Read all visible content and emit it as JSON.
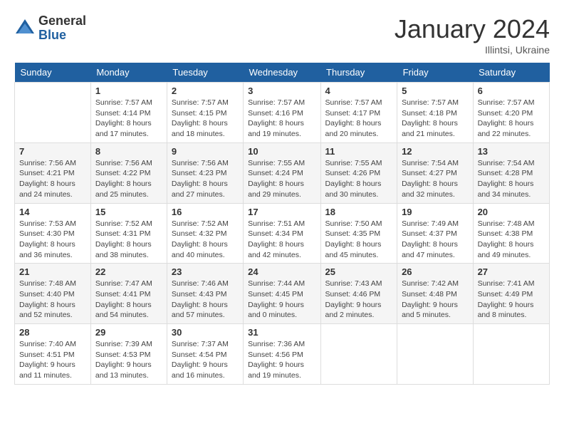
{
  "header": {
    "logo_general": "General",
    "logo_blue": "Blue",
    "month_title": "January 2024",
    "location": "Illintsi, Ukraine"
  },
  "days_of_week": [
    "Sunday",
    "Monday",
    "Tuesday",
    "Wednesday",
    "Thursday",
    "Friday",
    "Saturday"
  ],
  "weeks": [
    [
      {
        "num": "",
        "sunrise": "",
        "sunset": "",
        "daylight": ""
      },
      {
        "num": "1",
        "sunrise": "Sunrise: 7:57 AM",
        "sunset": "Sunset: 4:14 PM",
        "daylight": "Daylight: 8 hours and 17 minutes."
      },
      {
        "num": "2",
        "sunrise": "Sunrise: 7:57 AM",
        "sunset": "Sunset: 4:15 PM",
        "daylight": "Daylight: 8 hours and 18 minutes."
      },
      {
        "num": "3",
        "sunrise": "Sunrise: 7:57 AM",
        "sunset": "Sunset: 4:16 PM",
        "daylight": "Daylight: 8 hours and 19 minutes."
      },
      {
        "num": "4",
        "sunrise": "Sunrise: 7:57 AM",
        "sunset": "Sunset: 4:17 PM",
        "daylight": "Daylight: 8 hours and 20 minutes."
      },
      {
        "num": "5",
        "sunrise": "Sunrise: 7:57 AM",
        "sunset": "Sunset: 4:18 PM",
        "daylight": "Daylight: 8 hours and 21 minutes."
      },
      {
        "num": "6",
        "sunrise": "Sunrise: 7:57 AM",
        "sunset": "Sunset: 4:20 PM",
        "daylight": "Daylight: 8 hours and 22 minutes."
      }
    ],
    [
      {
        "num": "7",
        "sunrise": "Sunrise: 7:56 AM",
        "sunset": "Sunset: 4:21 PM",
        "daylight": "Daylight: 8 hours and 24 minutes."
      },
      {
        "num": "8",
        "sunrise": "Sunrise: 7:56 AM",
        "sunset": "Sunset: 4:22 PM",
        "daylight": "Daylight: 8 hours and 25 minutes."
      },
      {
        "num": "9",
        "sunrise": "Sunrise: 7:56 AM",
        "sunset": "Sunset: 4:23 PM",
        "daylight": "Daylight: 8 hours and 27 minutes."
      },
      {
        "num": "10",
        "sunrise": "Sunrise: 7:55 AM",
        "sunset": "Sunset: 4:24 PM",
        "daylight": "Daylight: 8 hours and 29 minutes."
      },
      {
        "num": "11",
        "sunrise": "Sunrise: 7:55 AM",
        "sunset": "Sunset: 4:26 PM",
        "daylight": "Daylight: 8 hours and 30 minutes."
      },
      {
        "num": "12",
        "sunrise": "Sunrise: 7:54 AM",
        "sunset": "Sunset: 4:27 PM",
        "daylight": "Daylight: 8 hours and 32 minutes."
      },
      {
        "num": "13",
        "sunrise": "Sunrise: 7:54 AM",
        "sunset": "Sunset: 4:28 PM",
        "daylight": "Daylight: 8 hours and 34 minutes."
      }
    ],
    [
      {
        "num": "14",
        "sunrise": "Sunrise: 7:53 AM",
        "sunset": "Sunset: 4:30 PM",
        "daylight": "Daylight: 8 hours and 36 minutes."
      },
      {
        "num": "15",
        "sunrise": "Sunrise: 7:52 AM",
        "sunset": "Sunset: 4:31 PM",
        "daylight": "Daylight: 8 hours and 38 minutes."
      },
      {
        "num": "16",
        "sunrise": "Sunrise: 7:52 AM",
        "sunset": "Sunset: 4:32 PM",
        "daylight": "Daylight: 8 hours and 40 minutes."
      },
      {
        "num": "17",
        "sunrise": "Sunrise: 7:51 AM",
        "sunset": "Sunset: 4:34 PM",
        "daylight": "Daylight: 8 hours and 42 minutes."
      },
      {
        "num": "18",
        "sunrise": "Sunrise: 7:50 AM",
        "sunset": "Sunset: 4:35 PM",
        "daylight": "Daylight: 8 hours and 45 minutes."
      },
      {
        "num": "19",
        "sunrise": "Sunrise: 7:49 AM",
        "sunset": "Sunset: 4:37 PM",
        "daylight": "Daylight: 8 hours and 47 minutes."
      },
      {
        "num": "20",
        "sunrise": "Sunrise: 7:48 AM",
        "sunset": "Sunset: 4:38 PM",
        "daylight": "Daylight: 8 hours and 49 minutes."
      }
    ],
    [
      {
        "num": "21",
        "sunrise": "Sunrise: 7:48 AM",
        "sunset": "Sunset: 4:40 PM",
        "daylight": "Daylight: 8 hours and 52 minutes."
      },
      {
        "num": "22",
        "sunrise": "Sunrise: 7:47 AM",
        "sunset": "Sunset: 4:41 PM",
        "daylight": "Daylight: 8 hours and 54 minutes."
      },
      {
        "num": "23",
        "sunrise": "Sunrise: 7:46 AM",
        "sunset": "Sunset: 4:43 PM",
        "daylight": "Daylight: 8 hours and 57 minutes."
      },
      {
        "num": "24",
        "sunrise": "Sunrise: 7:44 AM",
        "sunset": "Sunset: 4:45 PM",
        "daylight": "Daylight: 9 hours and 0 minutes."
      },
      {
        "num": "25",
        "sunrise": "Sunrise: 7:43 AM",
        "sunset": "Sunset: 4:46 PM",
        "daylight": "Daylight: 9 hours and 2 minutes."
      },
      {
        "num": "26",
        "sunrise": "Sunrise: 7:42 AM",
        "sunset": "Sunset: 4:48 PM",
        "daylight": "Daylight: 9 hours and 5 minutes."
      },
      {
        "num": "27",
        "sunrise": "Sunrise: 7:41 AM",
        "sunset": "Sunset: 4:49 PM",
        "daylight": "Daylight: 9 hours and 8 minutes."
      }
    ],
    [
      {
        "num": "28",
        "sunrise": "Sunrise: 7:40 AM",
        "sunset": "Sunset: 4:51 PM",
        "daylight": "Daylight: 9 hours and 11 minutes."
      },
      {
        "num": "29",
        "sunrise": "Sunrise: 7:39 AM",
        "sunset": "Sunset: 4:53 PM",
        "daylight": "Daylight: 9 hours and 13 minutes."
      },
      {
        "num": "30",
        "sunrise": "Sunrise: 7:37 AM",
        "sunset": "Sunset: 4:54 PM",
        "daylight": "Daylight: 9 hours and 16 minutes."
      },
      {
        "num": "31",
        "sunrise": "Sunrise: 7:36 AM",
        "sunset": "Sunset: 4:56 PM",
        "daylight": "Daylight: 9 hours and 19 minutes."
      },
      {
        "num": "",
        "sunrise": "",
        "sunset": "",
        "daylight": ""
      },
      {
        "num": "",
        "sunrise": "",
        "sunset": "",
        "daylight": ""
      },
      {
        "num": "",
        "sunrise": "",
        "sunset": "",
        "daylight": ""
      }
    ]
  ]
}
